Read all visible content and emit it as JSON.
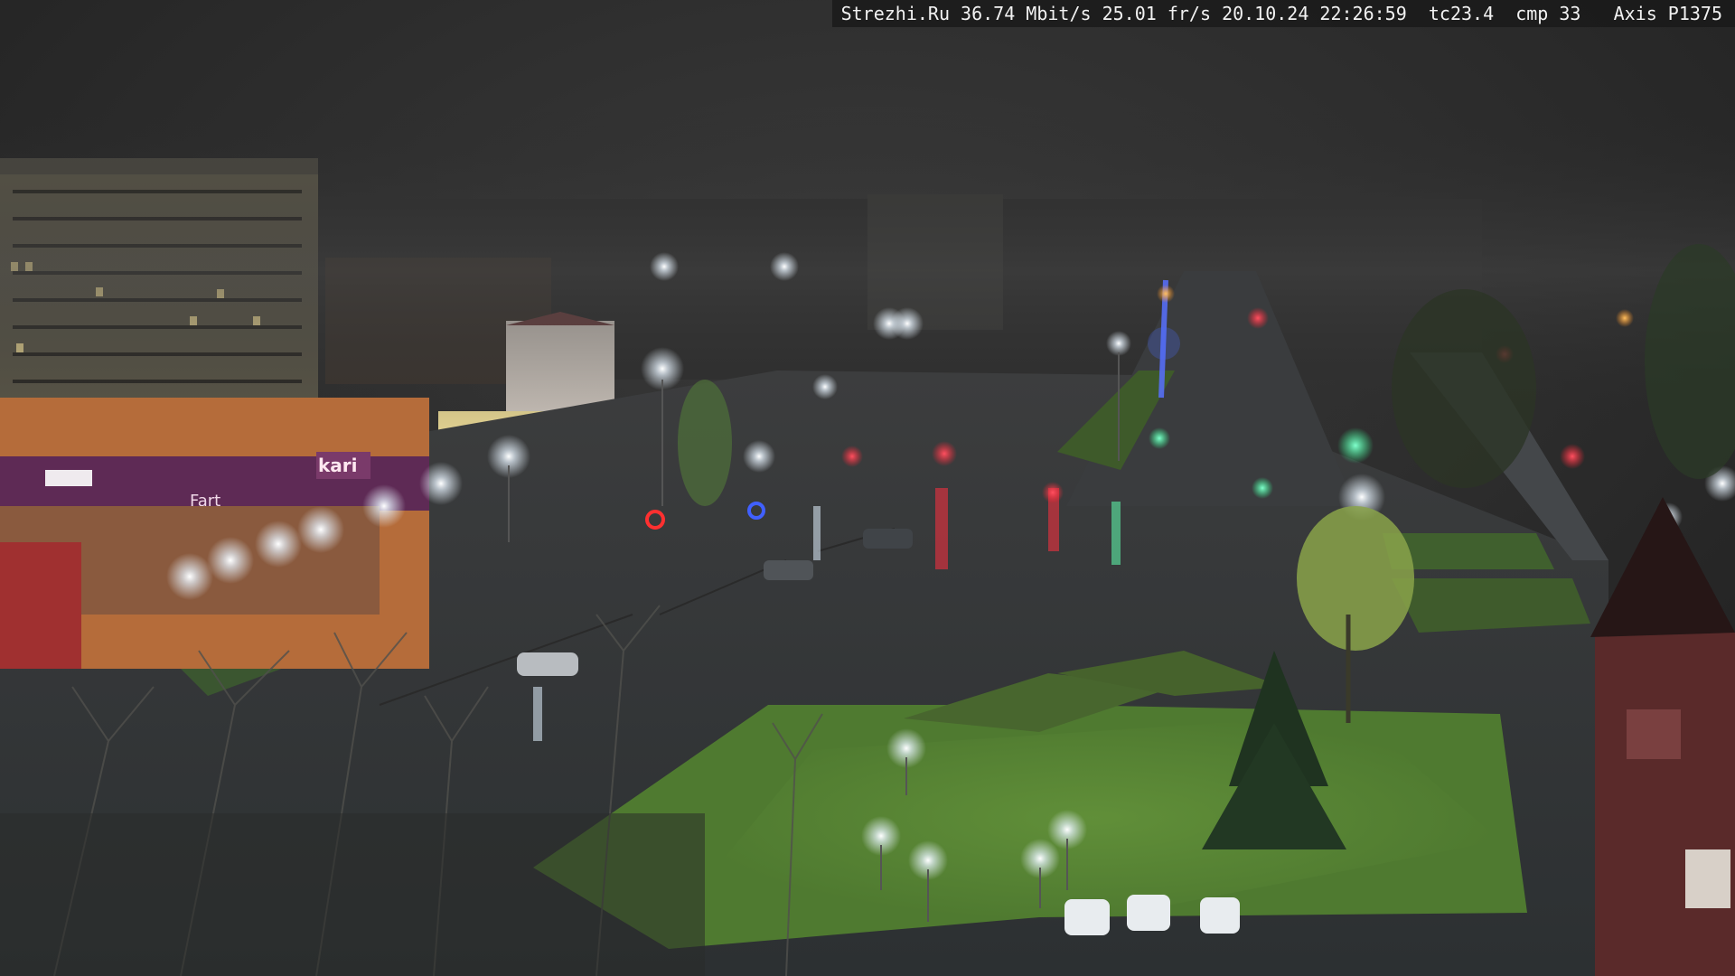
{
  "overlay": {
    "site": "Strezhi.Ru",
    "bitrate": "36.74 Mbit/s",
    "framerate": "25.01 fr/s",
    "datetime": "20.10.24 22:26:59",
    "tc": "tc23.4",
    "cmp": "cmp 33",
    "camera": "Axis P1375"
  },
  "scene": {
    "description_colors": {
      "sky": "#2a2a2a",
      "asphalt": "#3a3d40",
      "grass": "#3f5a2c",
      "lamp_glow": "#eef6ff",
      "traffic_red": "#ff2a3a",
      "traffic_green": "#44ffb0",
      "garland_blue": "#4a6aff",
      "shop_facade": "#c0703a",
      "shop_sign": "#6a2a5a"
    },
    "shop_sign_text": "kari",
    "shop_sign_small": "Fart"
  }
}
